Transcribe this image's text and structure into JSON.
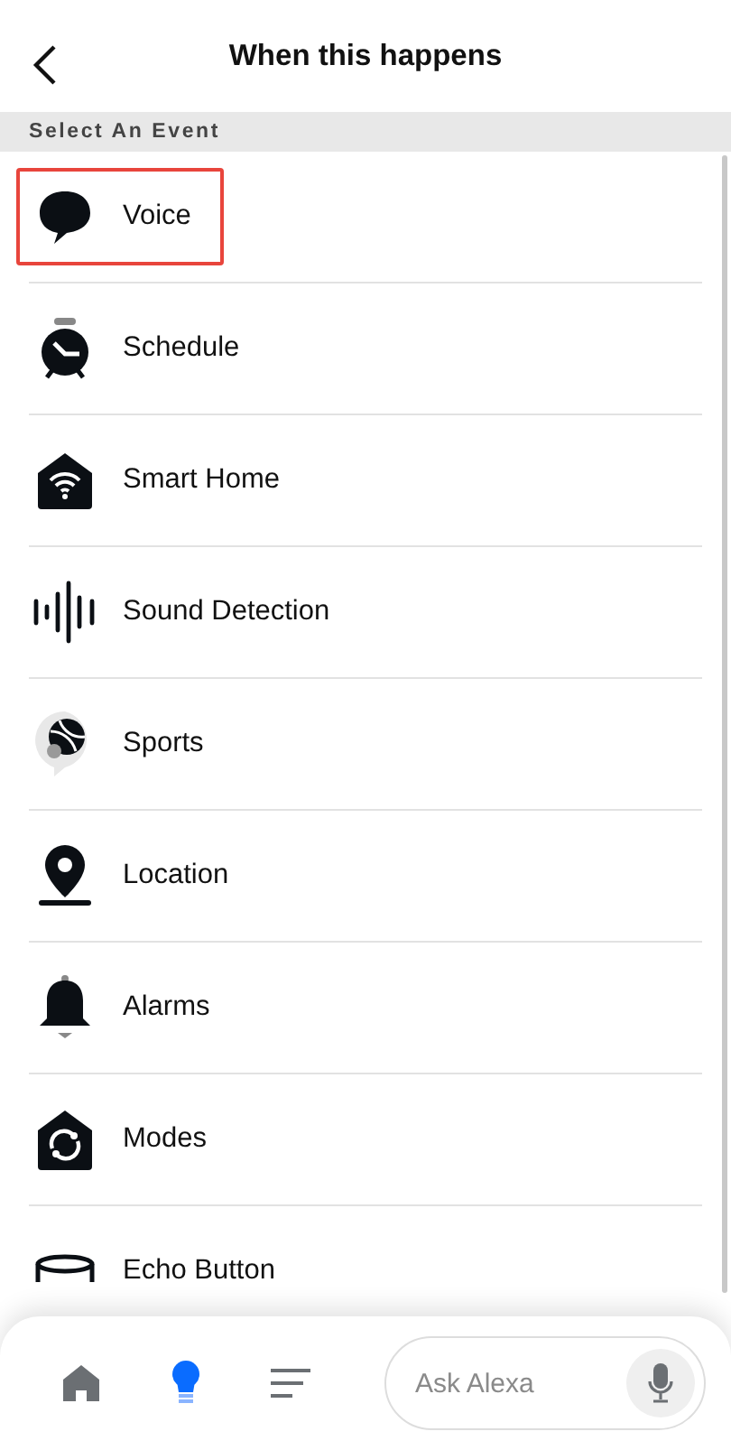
{
  "header": {
    "title": "When this happens"
  },
  "section": {
    "title": "Select An Event"
  },
  "events": [
    {
      "label": "Voice",
      "selected": true
    },
    {
      "label": "Schedule",
      "selected": false
    },
    {
      "label": "Smart Home",
      "selected": false
    },
    {
      "label": "Sound Detection",
      "selected": false
    },
    {
      "label": "Sports",
      "selected": false
    },
    {
      "label": "Location",
      "selected": false
    },
    {
      "label": "Alarms",
      "selected": false
    },
    {
      "label": "Modes",
      "selected": false
    },
    {
      "label": "Echo Button",
      "selected": false
    }
  ],
  "nav": [
    {
      "selected": false
    },
    {
      "selected": true
    },
    {
      "selected": false
    }
  ],
  "ask": {
    "placeholder": "Ask Alexa"
  }
}
